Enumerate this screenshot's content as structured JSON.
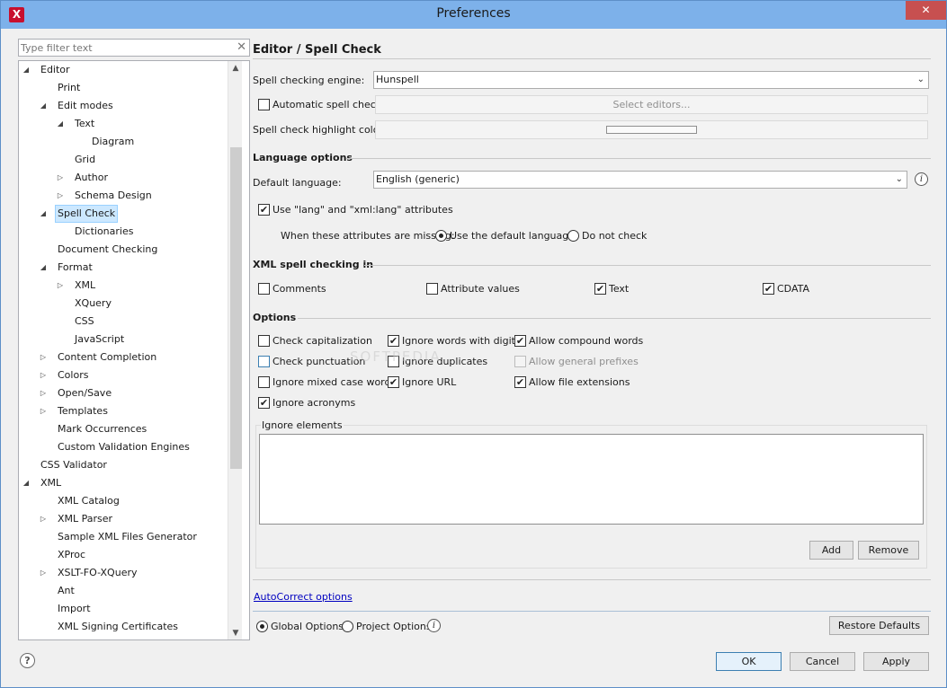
{
  "window": {
    "title": "Preferences",
    "close_icon": "✕"
  },
  "filter": {
    "placeholder": "Type filter text"
  },
  "tree": [
    {
      "label": "Editor",
      "arrow": "◢"
    },
    {
      "label": "Print",
      "arrow": ""
    },
    {
      "label": "Edit modes",
      "arrow": "◢"
    },
    {
      "label": "Text",
      "arrow": "◢"
    },
    {
      "label": "Diagram",
      "arrow": ""
    },
    {
      "label": "Grid",
      "arrow": ""
    },
    {
      "label": "Author",
      "arrow": "▷"
    },
    {
      "label": "Schema Design",
      "arrow": "▷"
    },
    {
      "label": "Spell Check",
      "arrow": "◢",
      "selected": true
    },
    {
      "label": "Dictionaries",
      "arrow": ""
    },
    {
      "label": "Document Checking",
      "arrow": ""
    },
    {
      "label": "Format",
      "arrow": "◢"
    },
    {
      "label": "XML",
      "arrow": "▷"
    },
    {
      "label": "XQuery",
      "arrow": ""
    },
    {
      "label": "CSS",
      "arrow": ""
    },
    {
      "label": "JavaScript",
      "arrow": ""
    },
    {
      "label": "Content Completion",
      "arrow": "▷"
    },
    {
      "label": "Colors",
      "arrow": "▷"
    },
    {
      "label": "Open/Save",
      "arrow": "▷"
    },
    {
      "label": "Templates",
      "arrow": "▷"
    },
    {
      "label": "Mark Occurrences",
      "arrow": ""
    },
    {
      "label": "Custom Validation Engines",
      "arrow": ""
    },
    {
      "label": "CSS Validator",
      "arrow": ""
    },
    {
      "label": "XML",
      "arrow": "◢"
    },
    {
      "label": "XML Catalog",
      "arrow": ""
    },
    {
      "label": "XML Parser",
      "arrow": "▷"
    },
    {
      "label": "Sample XML Files Generator",
      "arrow": ""
    },
    {
      "label": "XProc",
      "arrow": ""
    },
    {
      "label": "XSLT-FO-XQuery",
      "arrow": "▷"
    },
    {
      "label": "Ant",
      "arrow": ""
    },
    {
      "label": "Import",
      "arrow": ""
    },
    {
      "label": "XML Signing Certificates",
      "arrow": ""
    }
  ],
  "panel": {
    "title": "Editor / Spell Check",
    "engine_label": "Spell checking engine:",
    "engine_value": "Hunspell",
    "auto_check_label": "Automatic spell check:",
    "auto_check_checked": false,
    "select_editors_label": "Select editors...",
    "highlight_label": "Spell check highlight color:"
  },
  "language": {
    "section": "Language options",
    "default_label": "Default language:",
    "default_value": "English (generic)",
    "use_lang_label": "Use \"lang\" and \"xml:lang\" attributes",
    "use_lang_checked": true,
    "missing_label": "When these attributes are missing:",
    "opt_default": "Use the default language",
    "opt_no_check": "Do not check",
    "selected": "default"
  },
  "xml_check": {
    "section": "XML spell checking in",
    "comments": "Comments",
    "attributes": "Attribute values",
    "text": "Text",
    "cdata": "CDATA"
  },
  "options": {
    "section": "Options",
    "check_capitalization": "Check capitalization",
    "ignore_words_digits": "Ignore words with digits",
    "allow_compound": "Allow compound words",
    "check_punctuation": "Check punctuation",
    "ignore_duplicates": "Ignore duplicates",
    "allow_general_prefixes": "Allow general prefixes",
    "ignore_mixed_case": "Ignore mixed case words",
    "ignore_url": "Ignore URL",
    "allow_file_ext": "Allow file extensions",
    "ignore_acronyms": "Ignore acronyms",
    "ignore_elements_label": "Ignore elements",
    "add_label": "Add",
    "remove_label": "Remove"
  },
  "footer": {
    "autocorrect_link": "AutoCorrect options",
    "global_options": "Global Options",
    "project_options": "Project Options",
    "restore_defaults": "Restore Defaults",
    "ok": "OK",
    "cancel": "Cancel",
    "apply": "Apply"
  },
  "watermark": "SOFTPEDIA",
  "colors": {
    "titlebar": "#7db1ea",
    "selection": "#cce8ff",
    "link": "#0000c0"
  }
}
